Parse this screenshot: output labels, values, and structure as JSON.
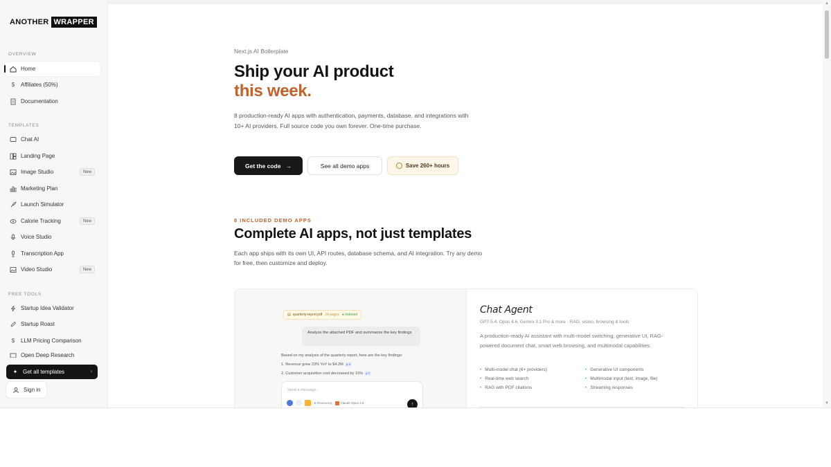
{
  "brand": {
    "part1": "ANOTHER",
    "part2": "WRAPPER"
  },
  "sidebar": {
    "sections": {
      "overview": "OVERVIEW",
      "templates": "TEMPLATES",
      "free_tools": "FREE TOOLS"
    },
    "overview_items": [
      {
        "label": "Home",
        "icon": "home-icon",
        "active": true
      },
      {
        "label": "Affiliates (50%)",
        "icon": "dollar-icon"
      },
      {
        "label": "Documentation",
        "icon": "document-icon"
      }
    ],
    "template_items": [
      {
        "label": "Chat AI",
        "icon": "chat-icon"
      },
      {
        "label": "Landing Page",
        "icon": "layout-icon"
      },
      {
        "label": "Image Studio",
        "icon": "image-icon",
        "badge": "New"
      },
      {
        "label": "Marketing Plan",
        "icon": "chart-icon"
      },
      {
        "label": "Launch Simulator",
        "icon": "rocket-icon"
      },
      {
        "label": "Calorie Tracking",
        "icon": "eye-icon",
        "badge": "New"
      },
      {
        "label": "Voice Studio",
        "icon": "mic-icon"
      },
      {
        "label": "Transcription App",
        "icon": "mic-stand-icon"
      },
      {
        "label": "Video Studio",
        "icon": "video-icon",
        "badge": "New"
      }
    ],
    "free_tool_items": [
      {
        "label": "Startup Idea Validator",
        "icon": "bolt-icon"
      },
      {
        "label": "Startup Roast",
        "icon": "pen-icon"
      },
      {
        "label": "LLM Pricing Comparison",
        "icon": "dollar-icon"
      },
      {
        "label": "Open Deep Research",
        "icon": "search-icon"
      }
    ],
    "cta": "Get all templates",
    "signin": "Sign in"
  },
  "hero": {
    "eyebrow": "Next.js AI Boilerplate",
    "title_line1": "Ship your AI product",
    "title_line2": "this week.",
    "description": "8 production-ready AI apps with authentication, payments, database, and integrations with 10+ AI providers. Full source code you own forever. One-time purchase.",
    "primary_button": "Get the code",
    "secondary_button": "See all demo apps",
    "save_button": "Save 260+ hours"
  },
  "apps_section": {
    "eyebrow": "8 INCLUDED DEMO APPS",
    "title": "Complete AI apps, not just templates",
    "description": "Each app ships with its own UI, API routes, database schema, and AI integration. Try any demo for free, then customize and deploy."
  },
  "demo": {
    "file_chip": {
      "name": "quarterly-report.pdf",
      "pages": "24 pages",
      "status": "Indexed"
    },
    "user_message": "Analyze the attached PDF and summarize the key findings",
    "assistant_intro": "Based on my analysis of the quarterly report, here are the key findings:",
    "findings": [
      {
        "text": "1. Revenue grew 23% YoY to $4.2M",
        "cite": "p.3"
      },
      {
        "text": "2. Customer acquisition cost decreased by 15%",
        "cite": "p.7"
      }
    ],
    "input_placeholder": "Send a message...",
    "reasoning_label": "Reasoning",
    "model_label": "Claude Opus 4.6"
  },
  "app_card": {
    "title": "Chat Agent",
    "subtitle": "GPT-5.4, Opus 4.6, Gemini 3.1 Pro & more · RAG, vision, browsing & tools",
    "description": "A production-ready AI assistant with multi-model switching, generative UI, RAG-powered document chat, smart web browsing, and multimodal capabilities.",
    "features": [
      "Multi-model chat (6+ providers)",
      "Generative UI components",
      "Real-time web search",
      "Multimodal input (text, image, file)",
      "RAG with PDF citations",
      "Streaming responses"
    ]
  }
}
